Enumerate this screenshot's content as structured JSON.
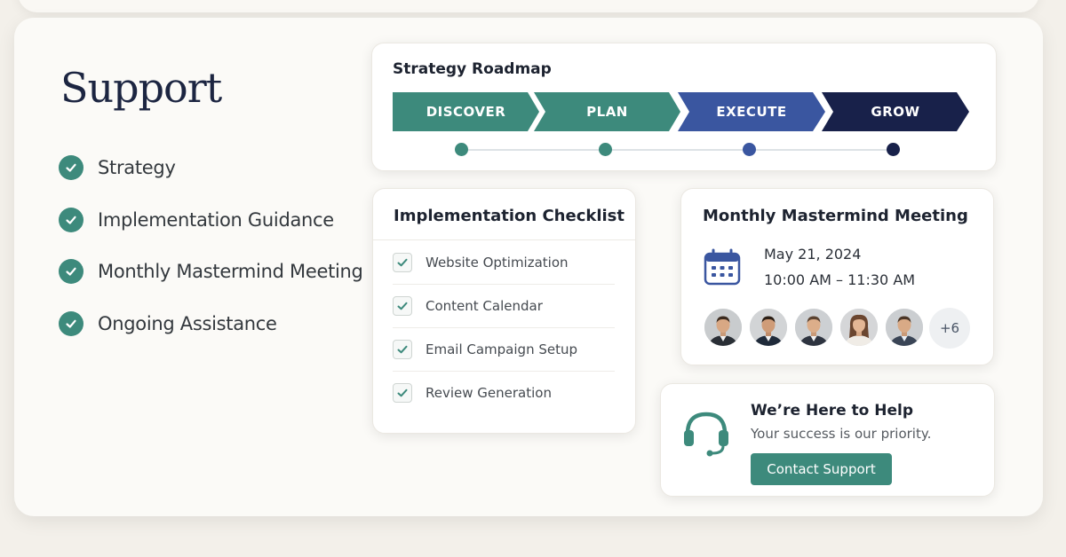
{
  "title": "Support",
  "features": [
    {
      "label": "Strategy"
    },
    {
      "label": "Implementation Guidance"
    },
    {
      "label": "Monthly Mastermind Meeting"
    },
    {
      "label": "Ongoing Assistance"
    }
  ],
  "roadmap": {
    "title": "Strategy Roadmap",
    "steps": [
      {
        "label": "DISCOVER",
        "color": "#3d8a7c"
      },
      {
        "label": "PLAN",
        "color": "#3d8a7c"
      },
      {
        "label": "EXECUTE",
        "color": "#3a56a0"
      },
      {
        "label": "GROW",
        "color": "#18214a"
      }
    ]
  },
  "checklist": {
    "title": "Implementation Checklist",
    "items": [
      {
        "label": "Website Optimization",
        "checked": true
      },
      {
        "label": "Content Calendar",
        "checked": true
      },
      {
        "label": "Email Campaign Setup",
        "checked": true
      },
      {
        "label": "Review Generation",
        "checked": true
      }
    ]
  },
  "meeting": {
    "title": "Monthly Mastermind Meeting",
    "date": "May 21, 2024",
    "time": "10:00 AM – 11:30 AM",
    "icon": "calendar-icon",
    "attendees": [
      "man-1",
      "man-2",
      "man-3",
      "woman-1",
      "man-4"
    ],
    "more_count": "+6"
  },
  "help": {
    "icon": "headset-icon",
    "title": "We’re Here to Help",
    "subtitle": "Your success is our priority.",
    "button_label": "Contact Support"
  },
  "colors": {
    "teal": "#3d8a7c",
    "blue": "#3a56a0",
    "navy": "#18214a",
    "title": "#1c2541"
  }
}
